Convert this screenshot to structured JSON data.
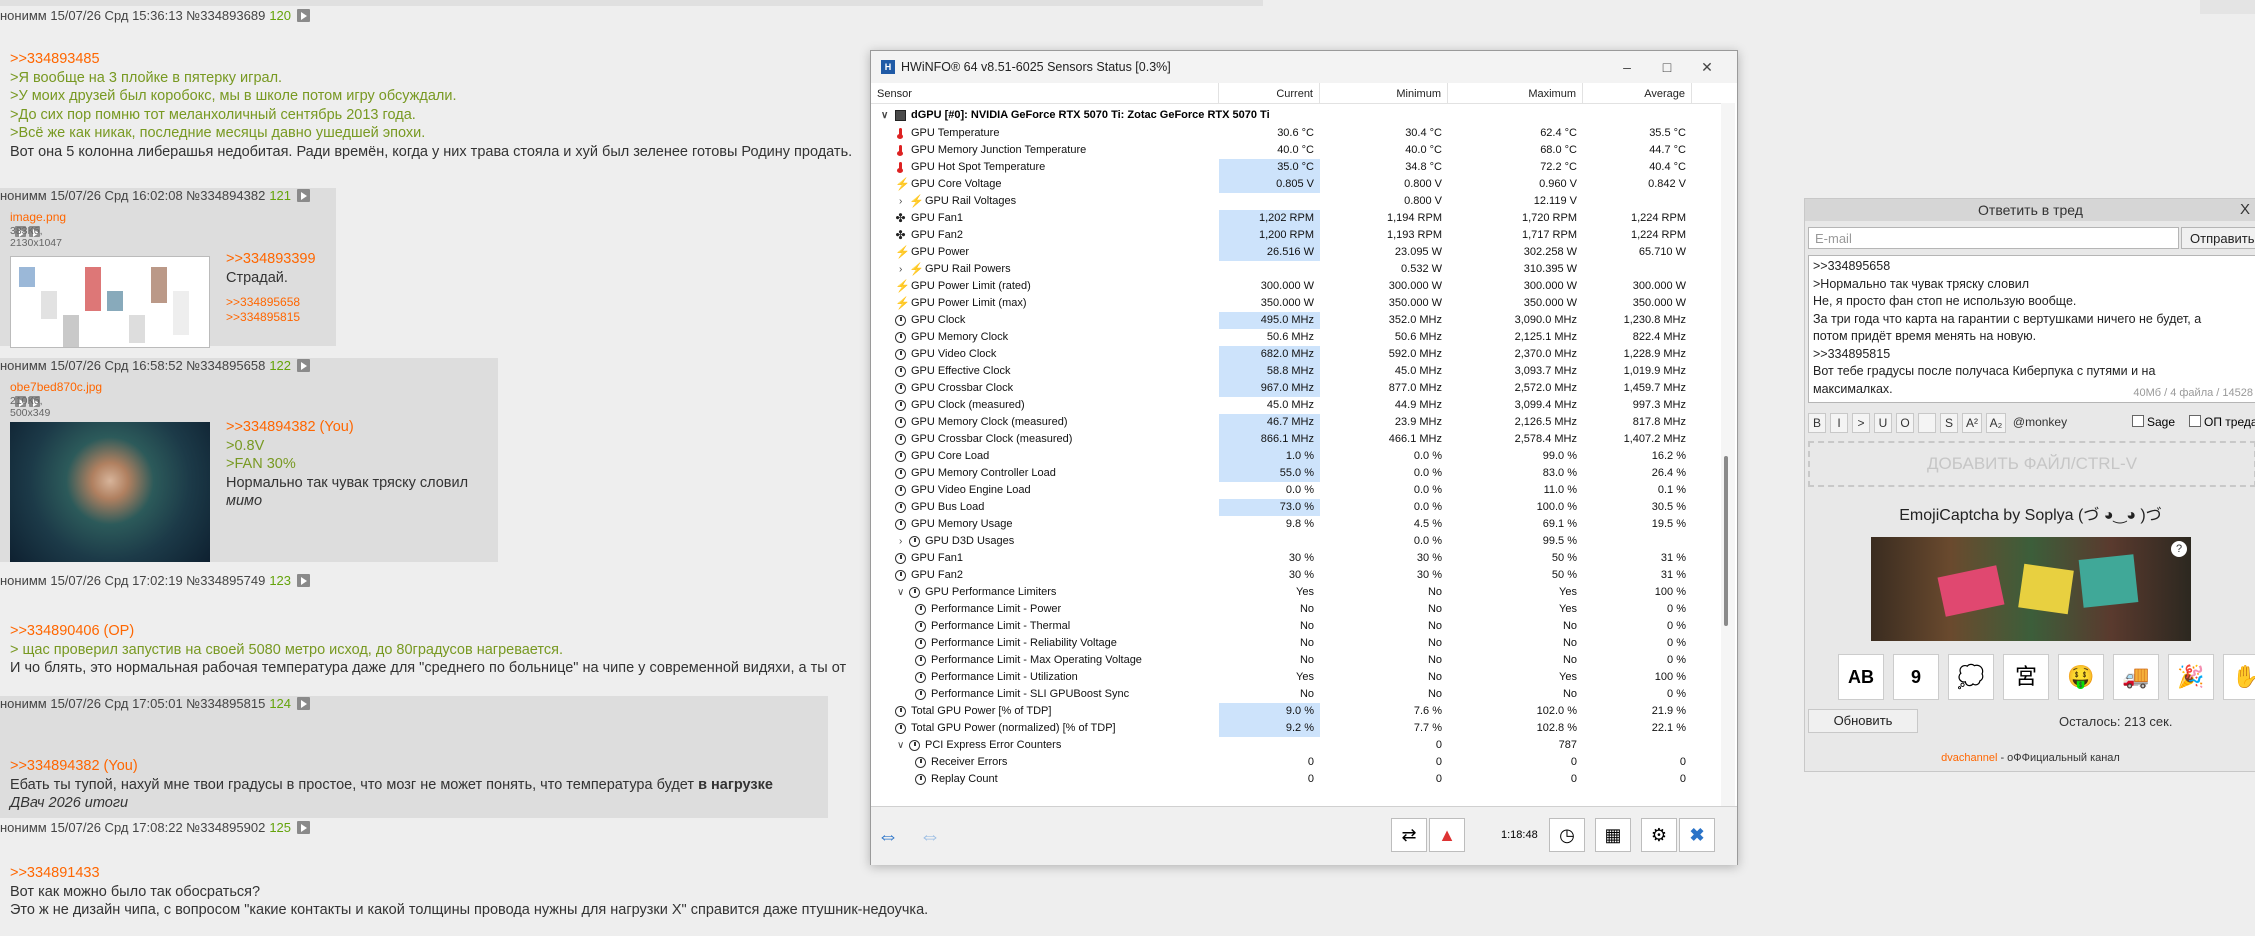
{
  "thread": {
    "posts": [
      {
        "header": "нонимм 15/07/26 Срд 15:36:13 №334893689",
        "num": "120",
        "lines": [
          {
            "c": "reply",
            "t": ">>334893485"
          },
          {
            "c": "quote",
            "t": ">Я вообще на 3 плойке в пятерку играл."
          },
          {
            "c": "quote",
            "t": ">У моих друзей был коробокс, мы в школе потом игру обсуждали."
          },
          {
            "c": "quote",
            "t": ">До сих пор помню тот меланхоличный сентябрь 2013 года."
          },
          {
            "c": "quote",
            "t": ">Всё же как никак, последние месяцы давно ушедшей эпохи."
          },
          {
            "c": "",
            "t": "Вот она 5 колонна либерашья недобитая. Ради времён, когда у них трава стояла и хуй был зеленее готовы Родину продать."
          }
        ]
      },
      {
        "header": "нонимм 15/07/26 Срд 16:02:08 №334894382",
        "num": "121",
        "file": {
          "name": "image.png",
          "meta": "383Кб, 2130x1047"
        },
        "lines": [
          {
            "c": "reply",
            "t": ">>334893399"
          },
          {
            "c": "",
            "t": "Страдай."
          }
        ],
        "replies": [
          ">>334895658",
          ">>334895815"
        ]
      },
      {
        "header": "нонимм 15/07/26 Срд 16:58:52 №334895658",
        "num": "122",
        "file": {
          "name": "obe7bed870c.jpg",
          "meta": "210Кб, 500x349"
        },
        "lines": [
          {
            "c": "reply",
            "t": ">>334894382 (You)"
          },
          {
            "c": "quote",
            "t": ">0.8V"
          },
          {
            "c": "quote",
            "t": ">FAN 30%"
          },
          {
            "c": "",
            "t": "Нормально так чувак тряску словил"
          },
          {
            "c": "ital",
            "t": "мимо"
          }
        ]
      },
      {
        "header": "нонимм 15/07/26 Срд 17:02:19 №334895749",
        "num": "123",
        "lines": [
          {
            "c": "reply",
            "t": ">>334890406 (OP)"
          },
          {
            "c": "quote",
            "t": "> щас проверил запустив на своей 5080 метро исход, до 80градусов нагревается."
          },
          {
            "c": "",
            "t": "И чо блять, это нормальная рабочая температура даже для \"среднего по больнице\" на чипе у современной видяхи, а ты от"
          }
        ]
      },
      {
        "header": "нонимм 15/07/26 Срд 17:05:01 №334895815",
        "num": "124",
        "lines": [
          {
            "c": "reply",
            "t": ">>334894382 (You)"
          },
          {
            "c": "",
            "t": "Ебать ты тупой, нахуй мне твои градусы в простое, что мозг не может понять, что температура будет ",
            "b": "в нагрузке"
          },
          {
            "c": "ital",
            "t": "ДВач 2026 итоги"
          }
        ]
      },
      {
        "header": "нонимм 15/07/26 Срд 17:08:22 №334895902",
        "num": "125",
        "lines": [
          {
            "c": "reply",
            "t": ">>334891433"
          },
          {
            "c": "",
            "t": "Вот как можно было так обосраться?"
          },
          {
            "c": "",
            "t": "Это ж не дизайн чипа, с вопросом \"какие контакты и какой толщины провода нужны для нагрузки X\" справится даже птушник-недоучка."
          }
        ]
      }
    ]
  },
  "hwinfo": {
    "title": "HWiNFO® 64 v8.51-6025 Sensors Status [0.3%]",
    "columns": [
      "Sensor",
      "Current",
      "Minimum",
      "Maximum",
      "Average"
    ],
    "group": "dGPU [#0]: NVIDIA GeForce RTX 5070 Ti: Zotac GeForce RTX 5070 Ti",
    "rows": [
      {
        "i": "therm",
        "n": "GPU Temperature",
        "v": [
          "30.6 °C",
          "30.4 °C",
          "62.4 °C",
          "35.5 °C"
        ]
      },
      {
        "i": "therm",
        "n": "GPU Memory Junction Temperature",
        "v": [
          "40.0 °C",
          "40.0 °C",
          "68.0 °C",
          "44.7 °C"
        ]
      },
      {
        "i": "therm",
        "n": "GPU Hot Spot Temperature",
        "v": [
          "35.0 °C",
          "34.8 °C",
          "72.2 °C",
          "40.4 °C"
        ],
        "hl": true
      },
      {
        "i": "bolt",
        "n": "GPU Core Voltage",
        "v": [
          "0.805 V",
          "0.800 V",
          "0.960 V",
          "0.842 V"
        ],
        "hl": true
      },
      {
        "i": "bolt",
        "n": "GPU Rail Voltages",
        "v": [
          "",
          "0.800 V",
          "12.119 V",
          ""
        ],
        "sub": true
      },
      {
        "i": "fan",
        "n": "GPU Fan1",
        "v": [
          "1,202 RPM",
          "1,194 RPM",
          "1,720 RPM",
          "1,224 RPM"
        ],
        "hl": true
      },
      {
        "i": "fan",
        "n": "GPU Fan2",
        "v": [
          "1,200 RPM",
          "1,193 RPM",
          "1,717 RPM",
          "1,224 RPM"
        ],
        "hl": true
      },
      {
        "i": "bolt",
        "n": "GPU Power",
        "v": [
          "26.516 W",
          "23.095 W",
          "302.258 W",
          "65.710 W"
        ],
        "hl": true
      },
      {
        "i": "bolt",
        "n": "GPU Rail Powers",
        "v": [
          "",
          "0.532 W",
          "310.395 W",
          ""
        ],
        "sub": true
      },
      {
        "i": "bolt",
        "n": "GPU Power Limit (rated)",
        "v": [
          "300.000 W",
          "300.000 W",
          "300.000 W",
          "300.000 W"
        ]
      },
      {
        "i": "bolt",
        "n": "GPU Power Limit (max)",
        "v": [
          "350.000 W",
          "350.000 W",
          "350.000 W",
          "350.000 W"
        ]
      },
      {
        "i": "clock",
        "n": "GPU Clock",
        "v": [
          "495.0 MHz",
          "352.0 MHz",
          "3,090.0 MHz",
          "1,230.8 MHz"
        ],
        "hl": true
      },
      {
        "i": "clock",
        "n": "GPU Memory Clock",
        "v": [
          "50.6 MHz",
          "50.6 MHz",
          "2,125.1 MHz",
          "822.4 MHz"
        ]
      },
      {
        "i": "clock",
        "n": "GPU Video Clock",
        "v": [
          "682.0 MHz",
          "592.0 MHz",
          "2,370.0 MHz",
          "1,228.9 MHz"
        ],
        "hl": true
      },
      {
        "i": "clock",
        "n": "GPU Effective Clock",
        "v": [
          "58.8 MHz",
          "45.0 MHz",
          "3,093.7 MHz",
          "1,019.9 MHz"
        ],
        "hl": true
      },
      {
        "i": "clock",
        "n": "GPU Crossbar Clock",
        "v": [
          "967.0 MHz",
          "877.0 MHz",
          "2,572.0 MHz",
          "1,459.7 MHz"
        ],
        "hl": true
      },
      {
        "i": "clock",
        "n": "GPU Clock (measured)",
        "v": [
          "45.0 MHz",
          "44.9 MHz",
          "3,099.4 MHz",
          "997.3 MHz"
        ]
      },
      {
        "i": "clock",
        "n": "GPU Memory Clock (measured)",
        "v": [
          "46.7 MHz",
          "23.9 MHz",
          "2,126.5 MHz",
          "817.8 MHz"
        ],
        "hl": true
      },
      {
        "i": "clock",
        "n": "GPU Crossbar Clock (measured)",
        "v": [
          "866.1 MHz",
          "466.1 MHz",
          "2,578.4 MHz",
          "1,407.2 MHz"
        ],
        "hl": true
      },
      {
        "i": "clock",
        "n": "GPU Core Load",
        "v": [
          "1.0 %",
          "0.0 %",
          "99.0 %",
          "16.2 %"
        ],
        "hl": true
      },
      {
        "i": "clock",
        "n": "GPU Memory Controller Load",
        "v": [
          "55.0 %",
          "0.0 %",
          "83.0 %",
          "26.4 %"
        ],
        "hl": true
      },
      {
        "i": "clock",
        "n": "GPU Video Engine Load",
        "v": [
          "0.0 %",
          "0.0 %",
          "11.0 %",
          "0.1 %"
        ]
      },
      {
        "i": "clock",
        "n": "GPU Bus Load",
        "v": [
          "73.0 %",
          "0.0 %",
          "100.0 %",
          "30.5 %"
        ],
        "hl": true
      },
      {
        "i": "clock",
        "n": "GPU Memory Usage",
        "v": [
          "9.8 %",
          "4.5 %",
          "69.1 %",
          "19.5 %"
        ]
      },
      {
        "i": "clock",
        "n": "GPU D3D Usages",
        "v": [
          "",
          "0.0 %",
          "99.5 %",
          ""
        ],
        "sub": true
      },
      {
        "i": "clock",
        "n": "GPU Fan1",
        "v": [
          "30 %",
          "30 %",
          "50 %",
          "31 %"
        ]
      },
      {
        "i": "clock",
        "n": "GPU Fan2",
        "v": [
          "30 %",
          "30 %",
          "50 %",
          "31 %"
        ]
      },
      {
        "i": "clock",
        "n": "GPU Performance Limiters",
        "v": [
          "Yes",
          "No",
          "Yes",
          "100 %"
        ],
        "open": true
      },
      {
        "i": "clock",
        "n": "Performance Limit - Power",
        "v": [
          "No",
          "No",
          "Yes",
          "0 %"
        ],
        "ind": true
      },
      {
        "i": "clock",
        "n": "Performance Limit - Thermal",
        "v": [
          "No",
          "No",
          "No",
          "0 %"
        ],
        "ind": true
      },
      {
        "i": "clock",
        "n": "Performance Limit - Reliability Voltage",
        "v": [
          "No",
          "No",
          "No",
          "0 %"
        ],
        "ind": true
      },
      {
        "i": "clock",
        "n": "Performance Limit - Max Operating Voltage",
        "v": [
          "No",
          "No",
          "No",
          "0 %"
        ],
        "ind": true
      },
      {
        "i": "clock",
        "n": "Performance Limit - Utilization",
        "v": [
          "Yes",
          "No",
          "Yes",
          "100 %"
        ],
        "ind": true
      },
      {
        "i": "clock",
        "n": "Performance Limit - SLI GPUBoost Sync",
        "v": [
          "No",
          "No",
          "No",
          "0 %"
        ],
        "ind": true
      },
      {
        "i": "clock",
        "n": "Total GPU Power [% of TDP]",
        "v": [
          "9.0 %",
          "7.6 %",
          "102.0 %",
          "21.9 %"
        ],
        "hl": true
      },
      {
        "i": "clock",
        "n": "Total GPU Power (normalized) [% of TDP]",
        "v": [
          "9.2 %",
          "7.7 %",
          "102.8 %",
          "22.1 %"
        ],
        "hl": true
      },
      {
        "i": "clock",
        "n": "PCI Express Error Counters",
        "v": [
          "",
          "0",
          "787",
          ""
        ],
        "open": true
      },
      {
        "i": "clock",
        "n": "Receiver Errors",
        "v": [
          "0",
          "0",
          "0",
          "0"
        ],
        "ind": true
      },
      {
        "i": "clock",
        "n": "Replay Count",
        "v": [
          "0",
          "0",
          "0",
          "0"
        ],
        "ind": true
      }
    ],
    "timer": "1:18:48"
  },
  "form": {
    "title": "Ответить в тред",
    "close": "X",
    "email_placeholder": "E-mail",
    "send": "Отправить",
    "text_lines": [
      ">>334895658",
      ">Нормально так чувак тряску словил",
      "Не, я просто фан стоп не использую вообще.",
      "За три года что карта на гарантии с вертушками ничего не будет, а",
      "потом придёт время менять на новую.",
      ">>334895815",
      "Вот тебе градусы после получаса Киберпука с путями и на",
      "максималках."
    ],
    "counter": "40Мб / 4 файла / 14528",
    "markup": [
      "B",
      "I",
      ">",
      "U",
      "O",
      "",
      "S",
      "A²",
      "A₂",
      "@monkey"
    ],
    "sage": "Sage",
    "op": "ОП треда",
    "drop": "ДОБАВИТЬ ФАЙЛ/CTRL-V",
    "captcha_title": "EmojiCaptcha by Soplya (づ ◕‿◕ )づ",
    "refresh": "Обновить",
    "remaining": "Осталось: 213 сек.",
    "channel_link": "dvachannel",
    "channel_suffix": " - оФФициальный канал"
  }
}
